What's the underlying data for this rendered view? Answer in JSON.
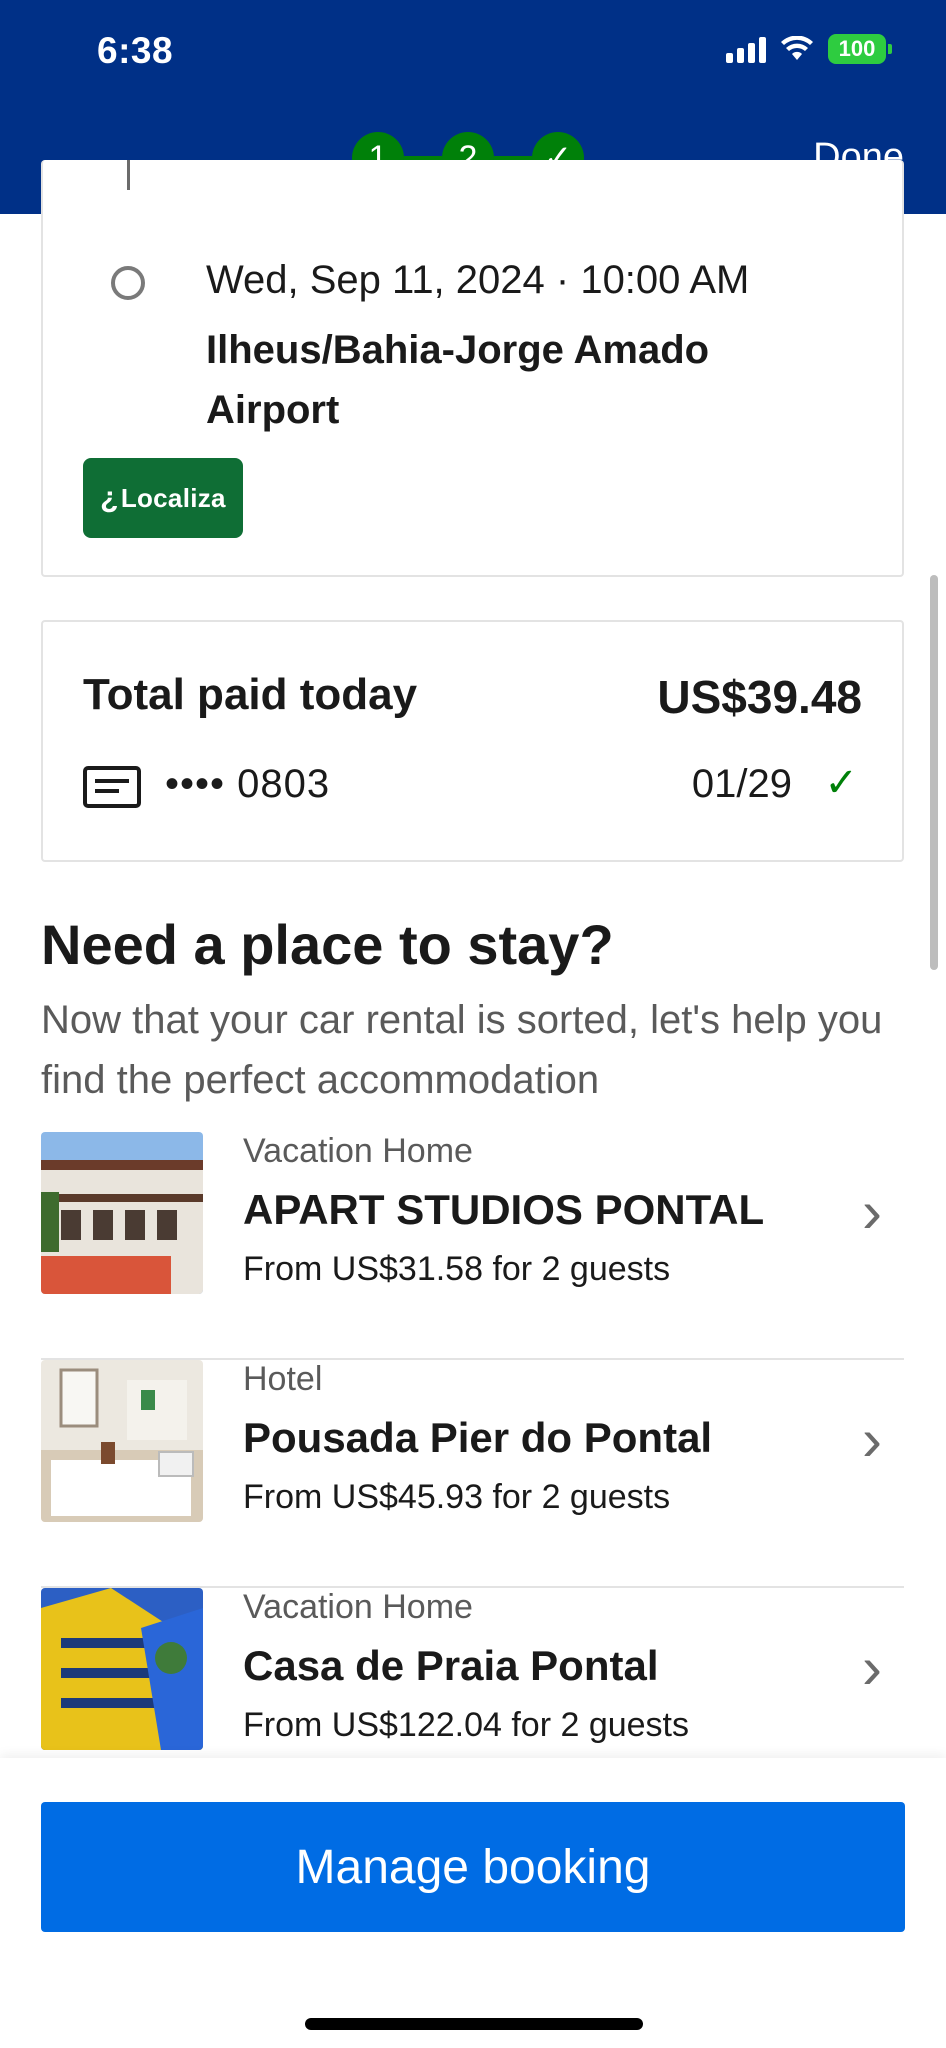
{
  "status_bar": {
    "time": "6:38",
    "battery": "100"
  },
  "header": {
    "steps": [
      "1",
      "2",
      "✓"
    ],
    "done_label": "Done"
  },
  "dropoff": {
    "datetime": "Wed, Sep 11, 2024 · 10:00 AM",
    "location": "Ilheus/Bahia-Jorge Amado Airport",
    "provider_logo_text": "Localiza"
  },
  "payment": {
    "label": "Total paid today",
    "amount": "US$39.48",
    "card_mask": "•••• 0803",
    "expiry": "01/29"
  },
  "stay": {
    "title": "Need a place to stay?",
    "subtitle": "Now that your car rental is sorted, let's help you find the perfect accommodation",
    "properties": [
      {
        "type": "Vacation Home",
        "name": "APART STUDIOS PONTAL",
        "price": "From US$31.58 for 2 guests"
      },
      {
        "type": "Hotel",
        "name": "Pousada Pier do Pontal",
        "price": "From US$45.93 for 2 guests"
      },
      {
        "type": "Vacation Home",
        "name": "Casa de Praia Pontal",
        "price": "From US$122.04 for 2 guests"
      }
    ]
  },
  "actions": {
    "manage_booking": "Manage booking"
  },
  "colors": {
    "header": "#003087",
    "accent_green": "#008009",
    "primary_blue": "#006ce4",
    "logo_green": "#0f6e35"
  }
}
